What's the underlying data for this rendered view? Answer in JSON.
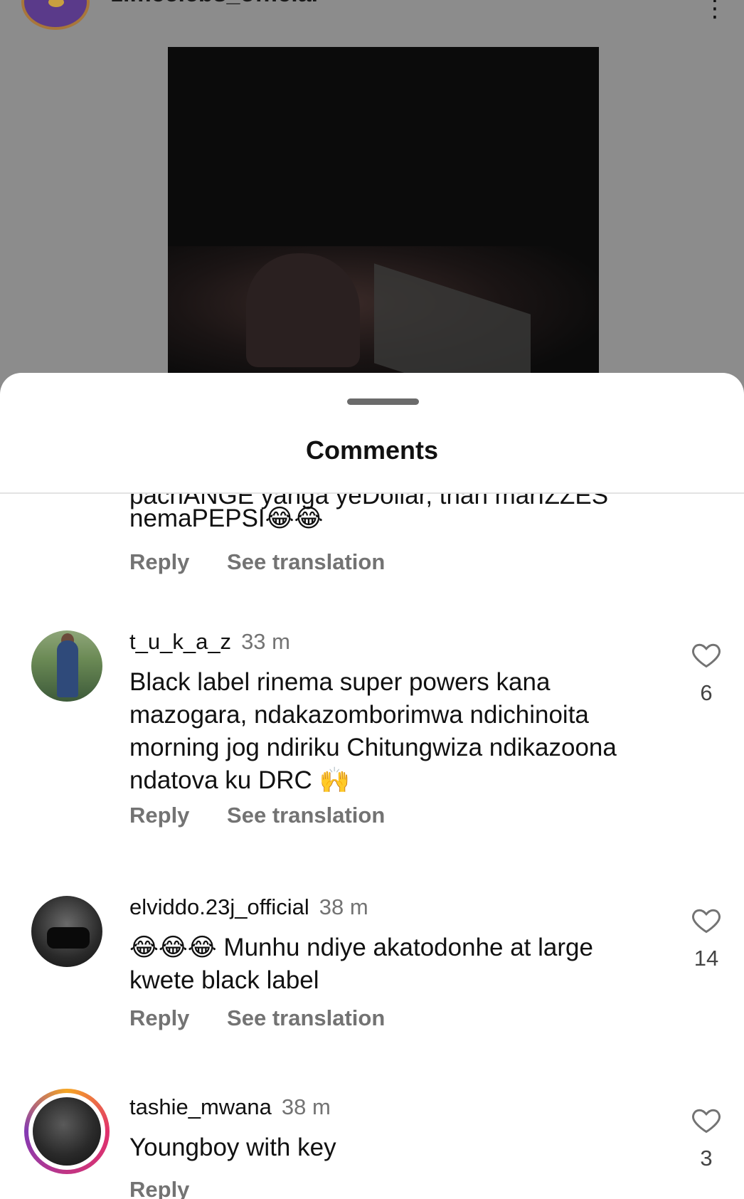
{
  "post": {
    "username": "zimcelebs_official",
    "more_icon": "more-dots-icon"
  },
  "sheet": {
    "title": "Comments"
  },
  "actions": {
    "reply": "Reply",
    "see_translation": "See translation"
  },
  "comments": [
    {
      "username": "",
      "time": "",
      "text_partial_top": "pachANGE yanga yeDollar, than marIZZES",
      "text": "nemaPEPSI😂😂",
      "likes": ""
    },
    {
      "username": "t_u_k_a_z",
      "time": "33 m",
      "text": "Black label rinema super powers kana mazogara, ndakazomborimwa ndichinoita morning jog ndiriku Chitungwiza ndikazoona ndatova ku DRC 🙌",
      "likes": "6"
    },
    {
      "username": "elviddo.23j_official",
      "time": "38 m",
      "text": "😂😂😂 Munhu ndiye akatodonhe at large kwete black label",
      "likes": "14"
    },
    {
      "username": "tashie_mwana",
      "time": "38 m",
      "text": "Youngboy with key",
      "likes": "3"
    }
  ]
}
